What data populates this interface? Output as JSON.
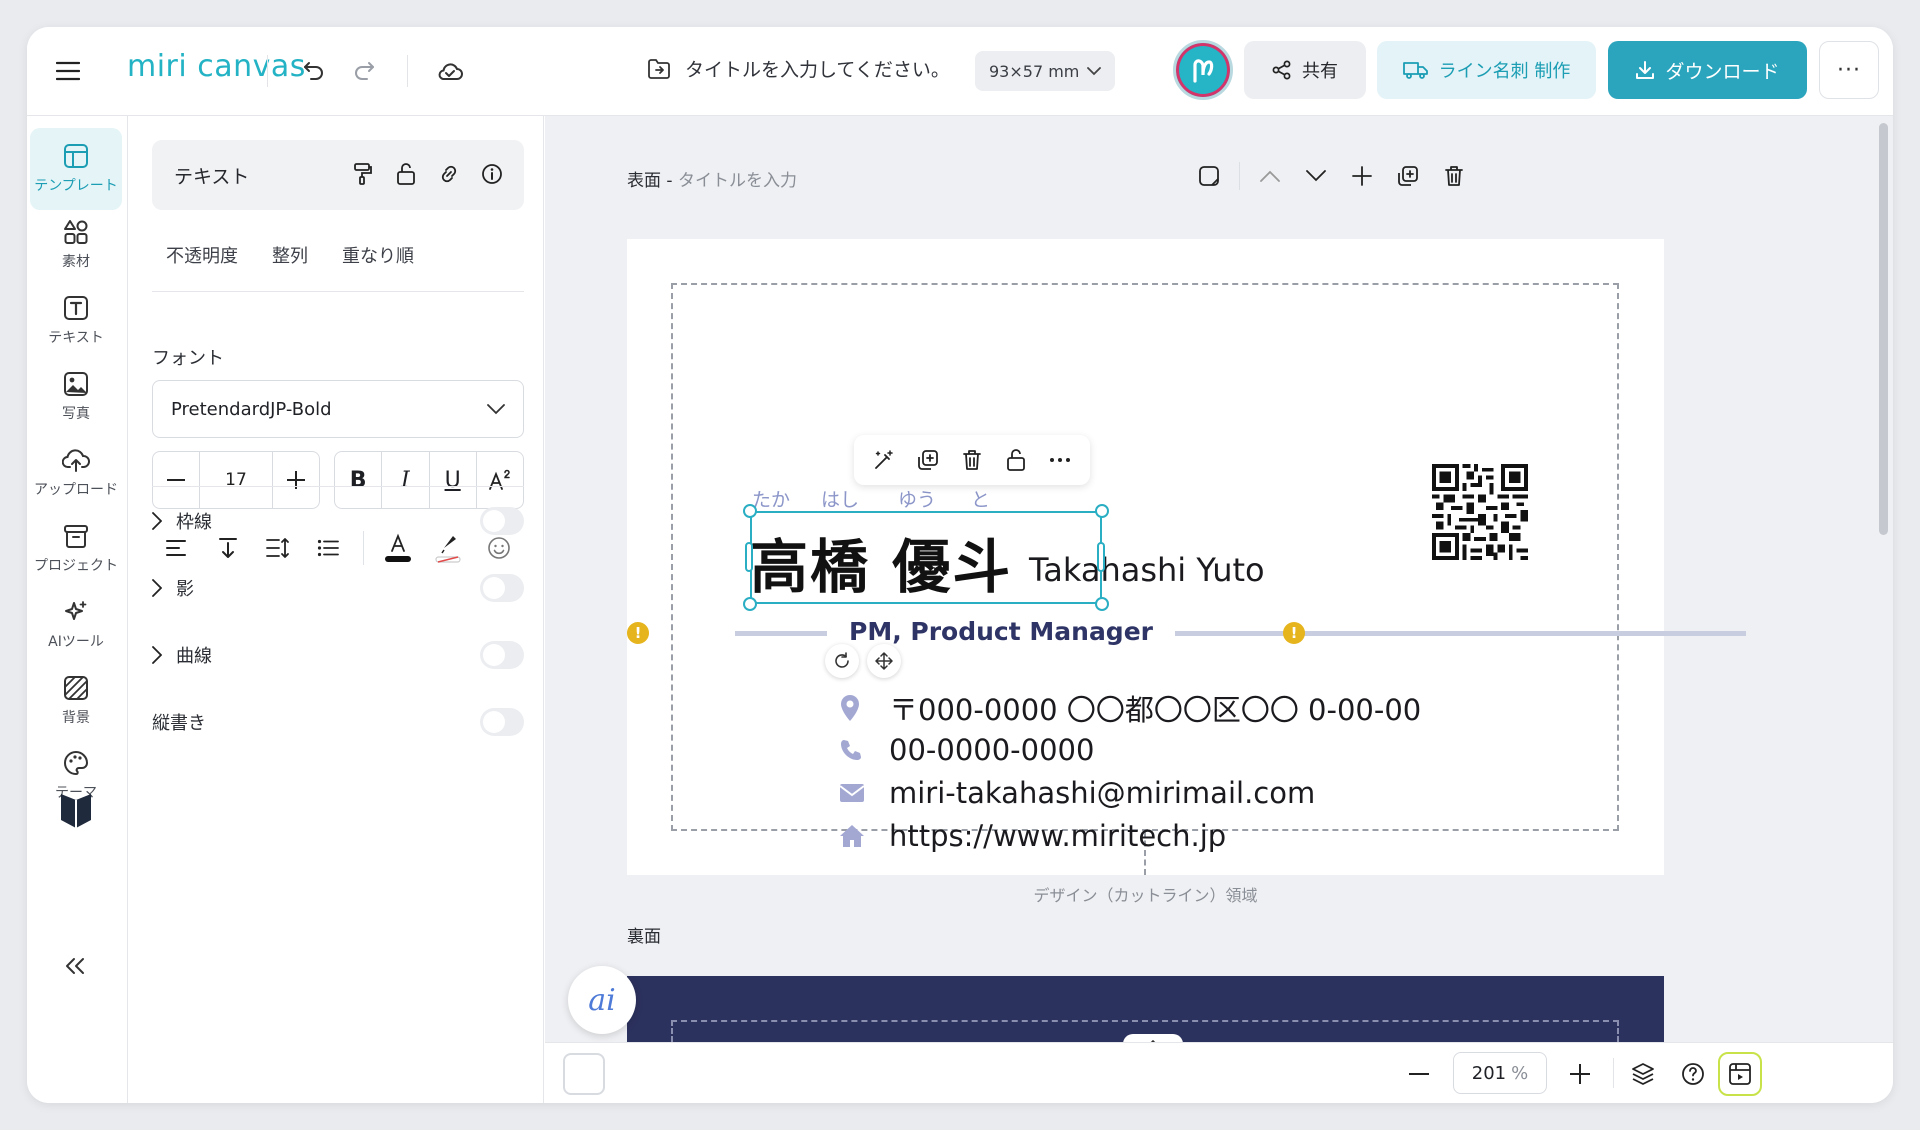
{
  "header": {
    "logo": "miri canvas",
    "doc_title_placeholder": "タイトルを入力してください。",
    "size": "93×57 mm",
    "share_label": "共有",
    "line_label": "ライン名刺 制作",
    "download_label": "ダウンロード",
    "more_label": "···"
  },
  "rail": {
    "items": [
      {
        "label": "テンプレート"
      },
      {
        "label": "素材"
      },
      {
        "label": "テキスト"
      },
      {
        "label": "写真"
      },
      {
        "label": "アップロード"
      },
      {
        "label": "プロジェクト"
      },
      {
        "label": "AIツール"
      },
      {
        "label": "背景"
      },
      {
        "label": "テーマ"
      }
    ]
  },
  "panel": {
    "title": "テキスト",
    "tabs": [
      "不透明度",
      "整列",
      "重なり順"
    ],
    "font_label": "フォント",
    "font_value": "PretendardJP-Bold",
    "font_size": "17",
    "style_bold": "B",
    "style_italic": "I",
    "style_underline": "U",
    "toggles": [
      "枠線",
      "影",
      "曲線"
    ],
    "vertical_label": "縦書き"
  },
  "canvas": {
    "front_label": "表面",
    "front_sep": " - ",
    "front_placeholder": "タイトルを入力",
    "back_label": "裏面",
    "cut_label": "デザイン（カットライン）領域",
    "ai_label": "ai"
  },
  "card": {
    "furigana": [
      "たか",
      "はし",
      "ゆう",
      "と"
    ],
    "name_jp": "高橋 優斗",
    "name_en": "Takahashi Yuto",
    "role": "PM, Product Manager",
    "address": "〒000-0000 〇〇都〇〇区〇〇 0-00-00",
    "phone": "00-0000-0000",
    "email": "miri-takahashi@mirimail.com",
    "website": "https://www.miritech.jp"
  },
  "bottom": {
    "zoom_value": "201",
    "zoom_unit": "%"
  },
  "colors": {
    "brand": "#2aa9bf",
    "card_navy": "#2c325e",
    "role_text": "#2e3466",
    "icon_lavender": "#a3a8d3"
  }
}
